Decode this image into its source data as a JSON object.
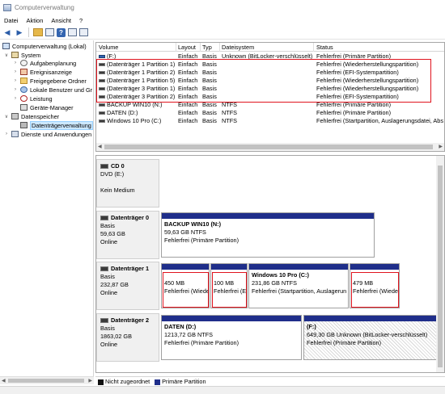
{
  "window": {
    "title": "Computerverwaltung"
  },
  "menu": [
    "Datei",
    "Aktion",
    "Ansicht",
    "?"
  ],
  "toolbar": {
    "buttons": [
      "back-icon",
      "forward-icon",
      "folder-up-icon",
      "properties-icon",
      "help-icon",
      "console-icon",
      "panel-icon"
    ]
  },
  "tree": {
    "root": "Computerverwaltung (Lokal)",
    "system": "System",
    "aufgabenplanung": "Aufgabenplanung",
    "ereignisanzeige": "Ereignisanzeige",
    "freigegebene_ordner": "Freigegebene Ordner",
    "lokale_benutzer": "Lokale Benutzer und Gr",
    "leistung": "Leistung",
    "geraete_manager": "Geräte-Manager",
    "datenspeicher": "Datenspeicher",
    "datentraegerverwaltung": "Datenträgerverwaltung",
    "dienste": "Dienste und Anwendungen"
  },
  "volume_table": {
    "headers": [
      "Volume",
      "Layout",
      "Typ",
      "Dateisystem",
      "Status"
    ],
    "rows": [
      [
        "(F:)",
        "Einfach",
        "Basis",
        "Unknown (BitLocker-verschlüsselt)",
        "Fehlerfrei (Primäre Partition)"
      ],
      [
        "(Datenträger 1 Partition 1)",
        "Einfach",
        "Basis",
        "",
        "Fehlerfrei (Wiederherstellungspartition)"
      ],
      [
        "(Datenträger 1 Partition 2)",
        "Einfach",
        "Basis",
        "",
        "Fehlerfrei (EFI-Systempartition)"
      ],
      [
        "(Datenträger 1 Partition 5)",
        "Einfach",
        "Basis",
        "",
        "Fehlerfrei (Wiederherstellungspartition)"
      ],
      [
        "(Datenträger 3 Partition 1)",
        "Einfach",
        "Basis",
        "",
        "Fehlerfrei (Wiederherstellungspartition)"
      ],
      [
        "(Datenträger 3 Partition 2)",
        "Einfach",
        "Basis",
        "",
        "Fehlerfrei (EFI-Systempartition)"
      ],
      [
        "BACKUP WIN10 (N:)",
        "Einfach",
        "Basis",
        "NTFS",
        "Fehlerfrei (Primäre Partition)"
      ],
      [
        "DATEN (D:)",
        "Einfach",
        "Basis",
        "NTFS",
        "Fehlerfrei (Primäre Partition)"
      ],
      [
        "Windows 10 Pro (C:)",
        "Einfach",
        "Basis",
        "NTFS",
        "Fehlerfrei (Startpartition, Auslagerungsdatei, Abs"
      ]
    ]
  },
  "disks": {
    "cd0": {
      "title": "CD 0",
      "line2": "DVD (E:)",
      "line3": "",
      "line4": "Kein Medium"
    },
    "d0": {
      "title": "Datenträger 0",
      "line2": "Basis",
      "line3": "59,63 GB",
      "line4": "Online"
    },
    "d1": {
      "title": "Datenträger 1",
      "line2": "Basis",
      "line3": "232,87 GB",
      "line4": "Online"
    },
    "d2": {
      "title": "Datenträger 2",
      "line2": "Basis",
      "line3": "1863,02 GB",
      "line4": "Online"
    }
  },
  "partitions": {
    "d0p1": {
      "name": "BACKUP WIN10  (N:)",
      "size": "59,63 GB NTFS",
      "status": "Fehlerfrei (Primäre Partition)"
    },
    "d1p1": {
      "name": "",
      "size": "450 MB",
      "status": "Fehlerfrei (Wiede"
    },
    "d1p2": {
      "name": "",
      "size": "100 MB",
      "status": "Fehlerfrei (E"
    },
    "d1p3": {
      "name": "Windows 10 Pro  (C:)",
      "size": "231,86 GB NTFS",
      "status": "Fehlerfrei (Startpartition, Auslagerun"
    },
    "d1p4": {
      "name": "",
      "size": "479 MB",
      "status": "Fehlerfrei (Wiede"
    },
    "d2p1": {
      "name": "DATEN  (D:)",
      "size": "1213,72 GB NTFS",
      "status": "Fehlerfrei (Primäre Partition)"
    },
    "d2p2": {
      "name": "(F:)",
      "size": "649,30 GB Unknown (BitLocker-verschlüsselt)",
      "status": "Fehlerfrei (Primäre Partition)"
    }
  },
  "legend": {
    "unallocated": "Nicht zugeordnet",
    "primary": "Primäre Partition"
  },
  "colors": {
    "partition_bar": "#1f2e8a",
    "highlight_red": "#e0141e",
    "selection": "#cce8ff"
  }
}
